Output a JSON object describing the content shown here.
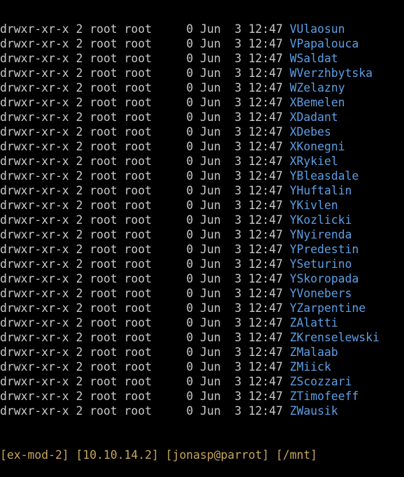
{
  "listing": [
    {
      "perms": "drwxr-xr-x",
      "links": "2",
      "owner": "root",
      "group": "root",
      "size": "0",
      "month": "Jun",
      "day": "3",
      "time": "12:47",
      "name": "VUlaosun"
    },
    {
      "perms": "drwxr-xr-x",
      "links": "2",
      "owner": "root",
      "group": "root",
      "size": "0",
      "month": "Jun",
      "day": "3",
      "time": "12:47",
      "name": "VPapalouca"
    },
    {
      "perms": "drwxr-xr-x",
      "links": "2",
      "owner": "root",
      "group": "root",
      "size": "0",
      "month": "Jun",
      "day": "3",
      "time": "12:47",
      "name": "WSaldat"
    },
    {
      "perms": "drwxr-xr-x",
      "links": "2",
      "owner": "root",
      "group": "root",
      "size": "0",
      "month": "Jun",
      "day": "3",
      "time": "12:47",
      "name": "WVerzhbytska"
    },
    {
      "perms": "drwxr-xr-x",
      "links": "2",
      "owner": "root",
      "group": "root",
      "size": "0",
      "month": "Jun",
      "day": "3",
      "time": "12:47",
      "name": "WZelazny"
    },
    {
      "perms": "drwxr-xr-x",
      "links": "2",
      "owner": "root",
      "group": "root",
      "size": "0",
      "month": "Jun",
      "day": "3",
      "time": "12:47",
      "name": "XBemelen"
    },
    {
      "perms": "drwxr-xr-x",
      "links": "2",
      "owner": "root",
      "group": "root",
      "size": "0",
      "month": "Jun",
      "day": "3",
      "time": "12:47",
      "name": "XDadant"
    },
    {
      "perms": "drwxr-xr-x",
      "links": "2",
      "owner": "root",
      "group": "root",
      "size": "0",
      "month": "Jun",
      "day": "3",
      "time": "12:47",
      "name": "XDebes"
    },
    {
      "perms": "drwxr-xr-x",
      "links": "2",
      "owner": "root",
      "group": "root",
      "size": "0",
      "month": "Jun",
      "day": "3",
      "time": "12:47",
      "name": "XKonegni"
    },
    {
      "perms": "drwxr-xr-x",
      "links": "2",
      "owner": "root",
      "group": "root",
      "size": "0",
      "month": "Jun",
      "day": "3",
      "time": "12:47",
      "name": "XRykiel"
    },
    {
      "perms": "drwxr-xr-x",
      "links": "2",
      "owner": "root",
      "group": "root",
      "size": "0",
      "month": "Jun",
      "day": "3",
      "time": "12:47",
      "name": "YBleasdale"
    },
    {
      "perms": "drwxr-xr-x",
      "links": "2",
      "owner": "root",
      "group": "root",
      "size": "0",
      "month": "Jun",
      "day": "3",
      "time": "12:47",
      "name": "YHuftalin"
    },
    {
      "perms": "drwxr-xr-x",
      "links": "2",
      "owner": "root",
      "group": "root",
      "size": "0",
      "month": "Jun",
      "day": "3",
      "time": "12:47",
      "name": "YKivlen"
    },
    {
      "perms": "drwxr-xr-x",
      "links": "2",
      "owner": "root",
      "group": "root",
      "size": "0",
      "month": "Jun",
      "day": "3",
      "time": "12:47",
      "name": "YKozlicki"
    },
    {
      "perms": "drwxr-xr-x",
      "links": "2",
      "owner": "root",
      "group": "root",
      "size": "0",
      "month": "Jun",
      "day": "3",
      "time": "12:47",
      "name": "YNyirenda"
    },
    {
      "perms": "drwxr-xr-x",
      "links": "2",
      "owner": "root",
      "group": "root",
      "size": "0",
      "month": "Jun",
      "day": "3",
      "time": "12:47",
      "name": "YPredestin"
    },
    {
      "perms": "drwxr-xr-x",
      "links": "2",
      "owner": "root",
      "group": "root",
      "size": "0",
      "month": "Jun",
      "day": "3",
      "time": "12:47",
      "name": "YSeturino"
    },
    {
      "perms": "drwxr-xr-x",
      "links": "2",
      "owner": "root",
      "group": "root",
      "size": "0",
      "month": "Jun",
      "day": "3",
      "time": "12:47",
      "name": "YSkoropada"
    },
    {
      "perms": "drwxr-xr-x",
      "links": "2",
      "owner": "root",
      "group": "root",
      "size": "0",
      "month": "Jun",
      "day": "3",
      "time": "12:47",
      "name": "YVonebers"
    },
    {
      "perms": "drwxr-xr-x",
      "links": "2",
      "owner": "root",
      "group": "root",
      "size": "0",
      "month": "Jun",
      "day": "3",
      "time": "12:47",
      "name": "YZarpentine"
    },
    {
      "perms": "drwxr-xr-x",
      "links": "2",
      "owner": "root",
      "group": "root",
      "size": "0",
      "month": "Jun",
      "day": "3",
      "time": "12:47",
      "name": "ZAlatti"
    },
    {
      "perms": "drwxr-xr-x",
      "links": "2",
      "owner": "root",
      "group": "root",
      "size": "0",
      "month": "Jun",
      "day": "3",
      "time": "12:47",
      "name": "ZKrenselewski"
    },
    {
      "perms": "drwxr-xr-x",
      "links": "2",
      "owner": "root",
      "group": "root",
      "size": "0",
      "month": "Jun",
      "day": "3",
      "time": "12:47",
      "name": "ZMalaab"
    },
    {
      "perms": "drwxr-xr-x",
      "links": "2",
      "owner": "root",
      "group": "root",
      "size": "0",
      "month": "Jun",
      "day": "3",
      "time": "12:47",
      "name": "ZMiick"
    },
    {
      "perms": "drwxr-xr-x",
      "links": "2",
      "owner": "root",
      "group": "root",
      "size": "0",
      "month": "Jun",
      "day": "3",
      "time": "12:47",
      "name": "ZScozzari"
    },
    {
      "perms": "drwxr-xr-x",
      "links": "2",
      "owner": "root",
      "group": "root",
      "size": "0",
      "month": "Jun",
      "day": "3",
      "time": "12:47",
      "name": "ZTimofeeff"
    },
    {
      "perms": "drwxr-xr-x",
      "links": "2",
      "owner": "root",
      "group": "root",
      "size": "0",
      "month": "Jun",
      "day": "3",
      "time": "12:47",
      "name": "ZWausik"
    }
  ],
  "prompt_partial": "[ex-mod-2] [10.10.14.2] [jonasp@parrot] [/mnt]",
  "colors": {
    "background": "#000000",
    "text": "#c9c9c9",
    "directory": "#5c9fe6",
    "prompt": "#c8a65b"
  }
}
